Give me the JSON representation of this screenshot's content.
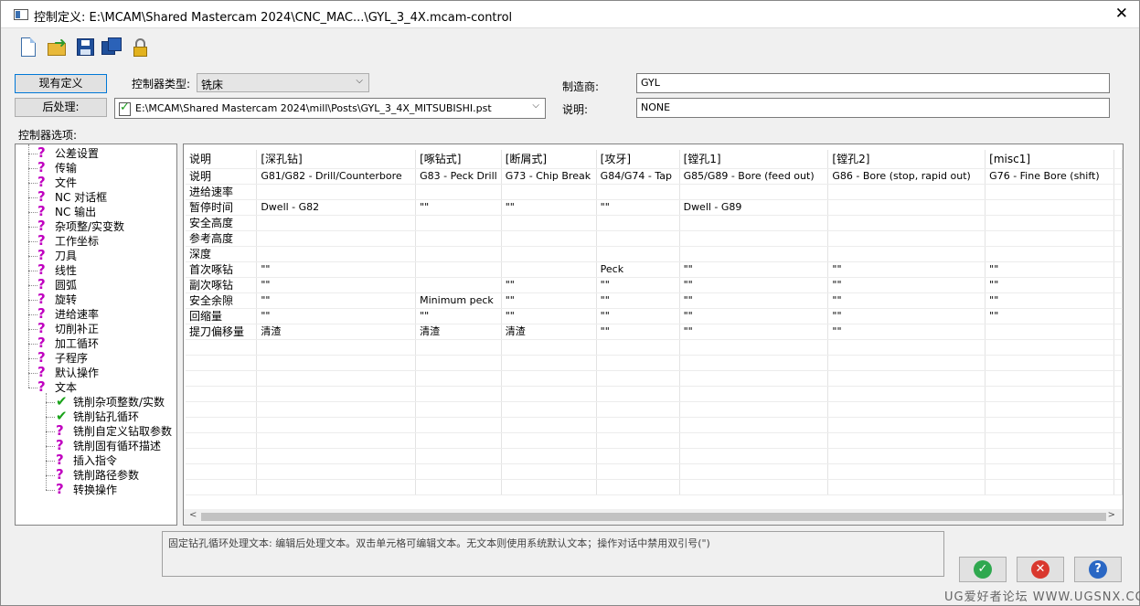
{
  "window": {
    "title": "控制定义: E:\\MCAM\\Shared Mastercam 2024\\CNC_MAC...\\GYL_3_4X.mcam-control",
    "close_glyph": "✕"
  },
  "toolbar": {
    "icons": [
      "new-file-icon",
      "open-folder-icon",
      "save-icon",
      "save-as-icon",
      "lock-icon"
    ]
  },
  "buttons": {
    "current_def": "现有定义",
    "post": "后处理:"
  },
  "controller_type": {
    "label": "控制器类型:",
    "value": "铣床"
  },
  "post_path": "E:\\MCAM\\Shared Mastercam 2024\\mill\\Posts\\GYL_3_4X_MITSUBISHI.pst",
  "manufacturer": {
    "label": "制造商:",
    "value": "GYL"
  },
  "description": {
    "label": "说明:",
    "value": "NONE"
  },
  "options_label": "控制器选项:",
  "tree": {
    "items": [
      "公差设置",
      "传输",
      "文件",
      "NC 对话框",
      "NC 输出",
      "杂项整/实变数",
      "工作坐标",
      "刀具",
      "线性",
      "圆弧",
      "旋转",
      "进给速率",
      "切削补正",
      "加工循环",
      "子程序",
      "默认操作",
      "文本"
    ],
    "children": [
      {
        "label": "铣削杂项整数/实数",
        "icon": "check"
      },
      {
        "label": "铣削钻孔循环",
        "icon": "check"
      },
      {
        "label": "铣削自定义钻取参数",
        "icon": "question"
      },
      {
        "label": "铣削固有循环描述",
        "icon": "question"
      },
      {
        "label": "插入指令",
        "icon": "question"
      },
      {
        "label": "铣削路径参数",
        "icon": "question"
      },
      {
        "label": "转换操作",
        "icon": "question"
      }
    ]
  },
  "grid": {
    "corner": "说明",
    "columns": [
      "[深孔钻]",
      "[啄钻式]",
      "[断屑式]",
      "[攻牙]",
      "[镗孔1]",
      "[镗孔2]",
      "[misc1]"
    ],
    "rows": [
      {
        "label": "说明",
        "cells": [
          "G81/G82 - Drill/Counterbore",
          "G83 - Peck Drill",
          "G73 - Chip Break",
          "G84/G74 - Tap",
          "G85/G89 - Bore (feed out)",
          "G86 - Bore (stop, rapid out)",
          "G76 - Fine Bore (shift)"
        ]
      },
      {
        "label": "进给速率",
        "cells": [
          "",
          "",
          "",
          "",
          "",
          "",
          ""
        ]
      },
      {
        "label": "暂停时间",
        "cells": [
          "Dwell - G82",
          "\"\"",
          "\"\"",
          "\"\"",
          "Dwell - G89",
          "",
          ""
        ]
      },
      {
        "label": "安全高度",
        "cells": [
          "",
          "",
          "",
          "",
          "",
          "",
          ""
        ]
      },
      {
        "label": "参考高度",
        "cells": [
          "",
          "",
          "",
          "",
          "",
          "",
          ""
        ]
      },
      {
        "label": "深度",
        "cells": [
          "",
          "",
          "",
          "",
          "",
          "",
          ""
        ]
      },
      {
        "label": "首次啄钻",
        "cells": [
          "\"\"",
          "",
          "",
          "Peck",
          "\"\"",
          "\"\"",
          "\"\""
        ]
      },
      {
        "label": "副次啄钻",
        "cells": [
          "\"\"",
          "",
          "\"\"",
          "\"\"",
          "\"\"",
          "\"\"",
          "\"\""
        ]
      },
      {
        "label": "安全余隙",
        "cells": [
          "\"\"",
          "Minimum peck",
          "\"\"",
          "\"\"",
          "\"\"",
          "\"\"",
          "\"\""
        ]
      },
      {
        "label": "回缩量",
        "cells": [
          "\"\"",
          "\"\"",
          "\"\"",
          "\"\"",
          "\"\"",
          "\"\"",
          "\"\""
        ]
      },
      {
        "label": "提刀偏移量",
        "cells": [
          "清渣",
          "清渣",
          "清渣",
          "\"\"",
          "\"\"",
          "\"\"",
          ""
        ]
      }
    ]
  },
  "status_text": "固定钻孔循环处理文本: 编辑后处理文本。双击单元格可编辑文本。无文本则使用系统默认文本；操作对话中禁用双引号(\")",
  "dialog_buttons": {
    "ok": "✓",
    "cancel": "✕",
    "help": "?"
  },
  "colors": {
    "ok": "#2fa84f",
    "cancel": "#d9382e",
    "help": "#2a67c4"
  },
  "watermark": "UG爱好者论坛 WWW.UGSNX.COM"
}
